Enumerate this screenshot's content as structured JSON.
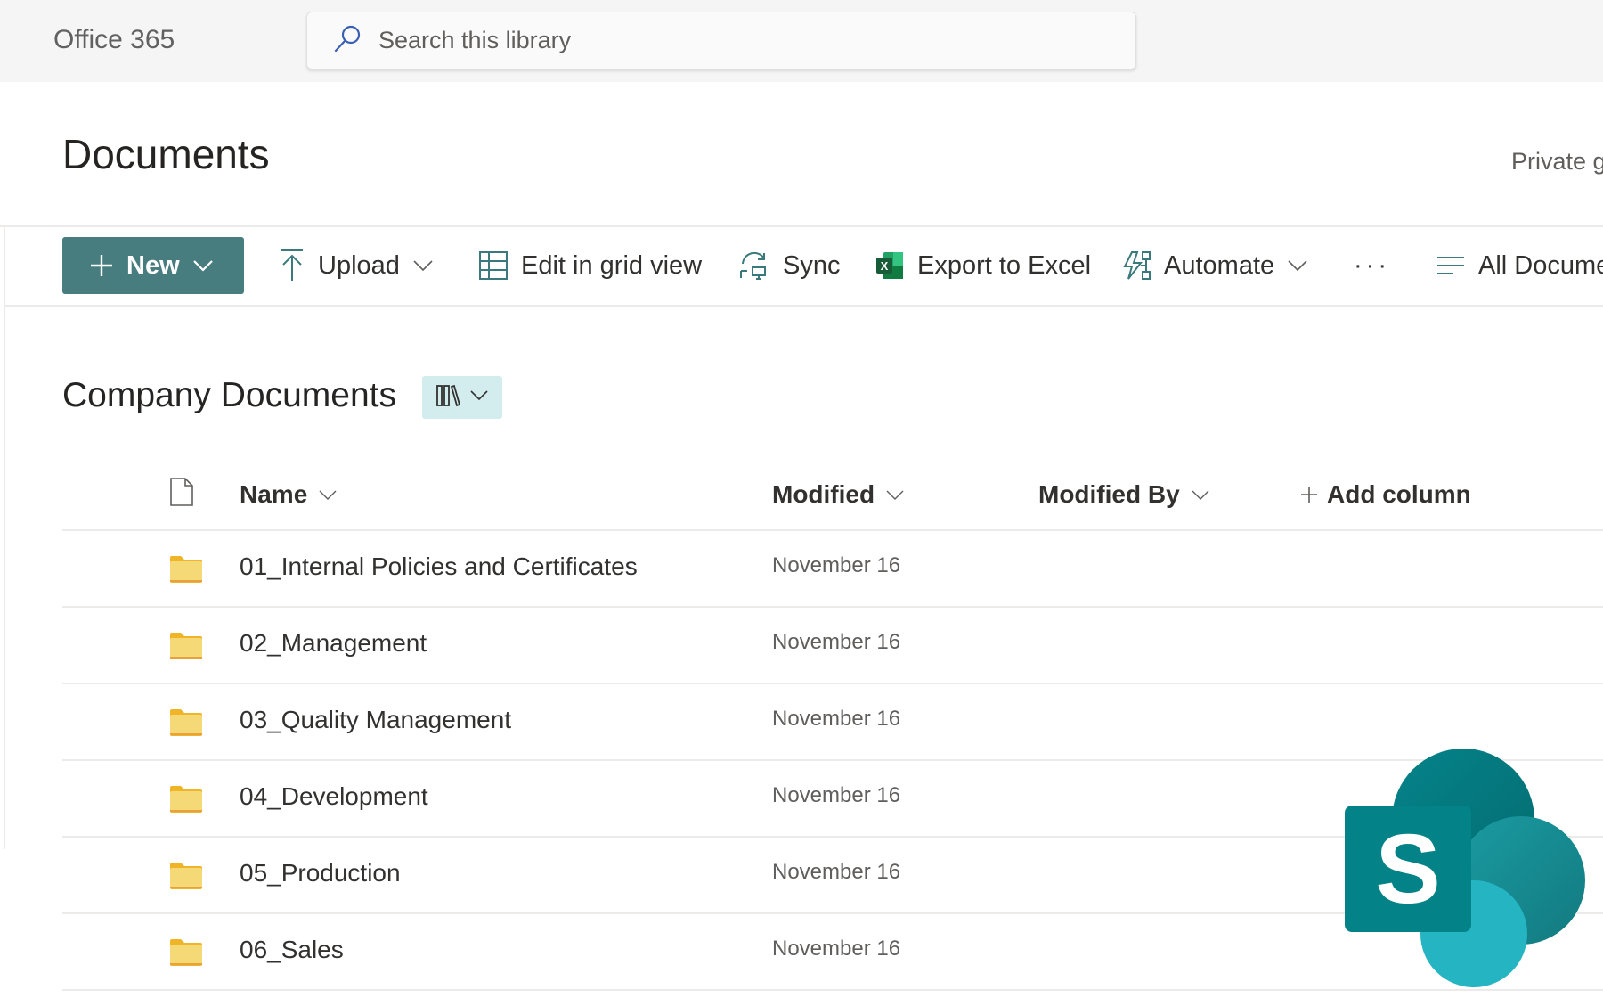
{
  "header": {
    "app_name": "Office 365",
    "search_placeholder": "Search this library"
  },
  "page": {
    "title": "Documents",
    "privacy_label": "Private g"
  },
  "toolbar": {
    "new_label": "New",
    "upload_label": "Upload",
    "grid_label": "Edit in grid view",
    "sync_label": "Sync",
    "export_label": "Export to Excel",
    "automate_label": "Automate",
    "more_label": "···",
    "view_label": "All Docume"
  },
  "library": {
    "title": "Company Documents"
  },
  "columns": {
    "name": "Name",
    "modified": "Modified",
    "modified_by": "Modified By",
    "add_column": "Add column"
  },
  "rows": [
    {
      "name": "01_Internal Policies and Certificates",
      "modified": "November 16",
      "modified_by": ""
    },
    {
      "name": "02_Management",
      "modified": "November 16",
      "modified_by": ""
    },
    {
      "name": "03_Quality Management",
      "modified": "November 16",
      "modified_by": ""
    },
    {
      "name": "04_Development",
      "modified": "November 16",
      "modified_by": ""
    },
    {
      "name": "05_Production",
      "modified": "November 16",
      "modified_by": ""
    },
    {
      "name": "06_Sales",
      "modified": "November 16",
      "modified_by": ""
    }
  ],
  "colors": {
    "accent": "#487d7f",
    "view_button_bg": "#d3edee",
    "folder": "#f5d977",
    "header_bg": "#f5f5f5"
  },
  "logo": {
    "letter": "S",
    "product": "SharePoint"
  }
}
